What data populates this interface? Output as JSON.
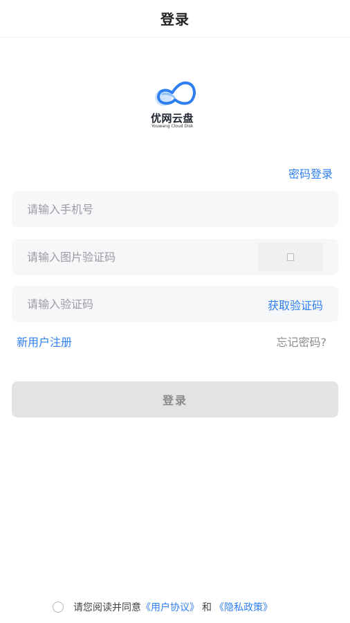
{
  "header": {
    "title": "登录"
  },
  "logo": {
    "name": "优网云盘",
    "subtitle": "Youwang Cloud Disk",
    "icon": "cloud-logo-icon",
    "color": "#2f7ff0"
  },
  "login_mode_switch": "密码登录",
  "form": {
    "phone_placeholder": "请输入手机号",
    "captcha_placeholder": "请输入图片验证码",
    "captcha_image_icon": "broken-image-icon",
    "code_placeholder": "请输入验证码",
    "get_code_label": "获取验证码"
  },
  "links": {
    "register": "新用户注册",
    "forgot": "忘记密码?"
  },
  "login_button": "登录",
  "agreement": {
    "prefix": "请您阅读并同意",
    "user_agreement": "《用户协议》",
    "and": "和",
    "privacy_policy": "《隐私政策》"
  },
  "colors": {
    "accent": "#2f7ff0",
    "field_bg": "#f6f7f9",
    "button_disabled": "#e3e3e3"
  }
}
